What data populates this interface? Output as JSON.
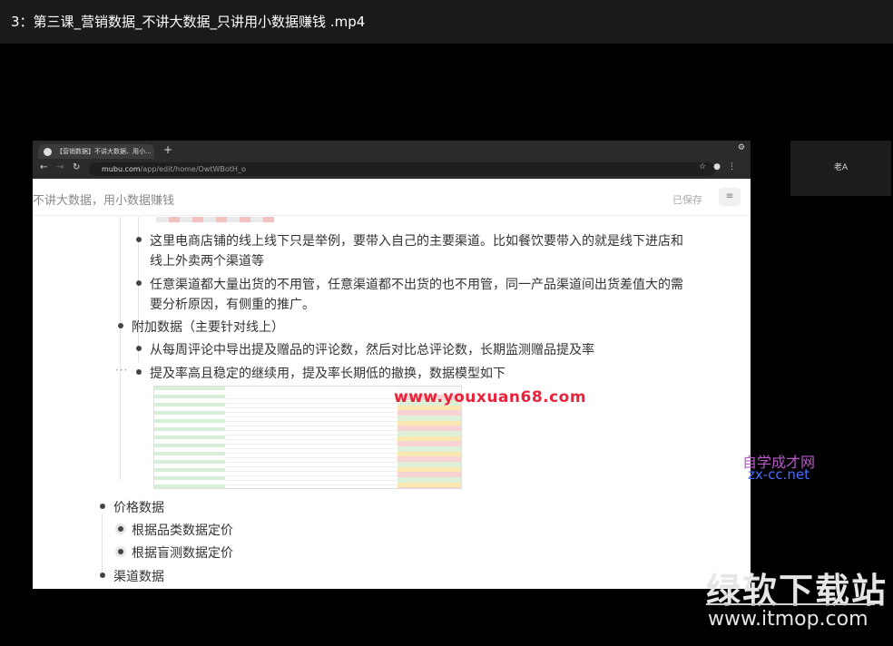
{
  "player": {
    "title": "3：第三课_营销数据_不讲大数据_只讲用小数据赚钱 .mp4"
  },
  "browser": {
    "tab_title": "【营销数据】不讲大数据、用小...",
    "new_tab": "+",
    "url_host": "mubu.com",
    "url_path": "/app/edit/home/OwtWBotH_o"
  },
  "doc": {
    "title": "不讲大数据，用小数据赚钱",
    "saved_label": "已保存",
    "outline": [
      {
        "text": "这里电商店铺的线上线下只是举例，要带入自己的主要渠道。比如餐饮要带入的就是线下进店和"
      },
      {
        "text": "线上外卖两个渠道等"
      },
      {
        "text": "任意渠道都大量出货的不用管，任意渠道都不出货的也不用管，同一产品渠道间出货差值大的需"
      },
      {
        "text": "要分析原因，有侧重的推广。"
      },
      {
        "text": "附加数据（主要针对线上）"
      },
      {
        "text": "从每周评论中导出提及赠品的评论数，然后对比总评论数，长期监测赠品提及率"
      },
      {
        "text": "提及率高且稳定的继续用，提及率长期低的撤换，数据模型如下"
      },
      {
        "text": "价格数据"
      },
      {
        "text": "根据品类数据定价"
      },
      {
        "text": "根据盲测数据定价"
      },
      {
        "text": "渠道数据"
      }
    ],
    "more_label": "···"
  },
  "side_panel": {
    "label": "老A"
  },
  "watermarks": {
    "youxuan": "www.youxuan68.com",
    "zx_cn": "自学成才网",
    "zx_en": "zx-cc.net",
    "itmop_cn": "绿软下载站",
    "itmop_en": "www.itmop.com"
  }
}
